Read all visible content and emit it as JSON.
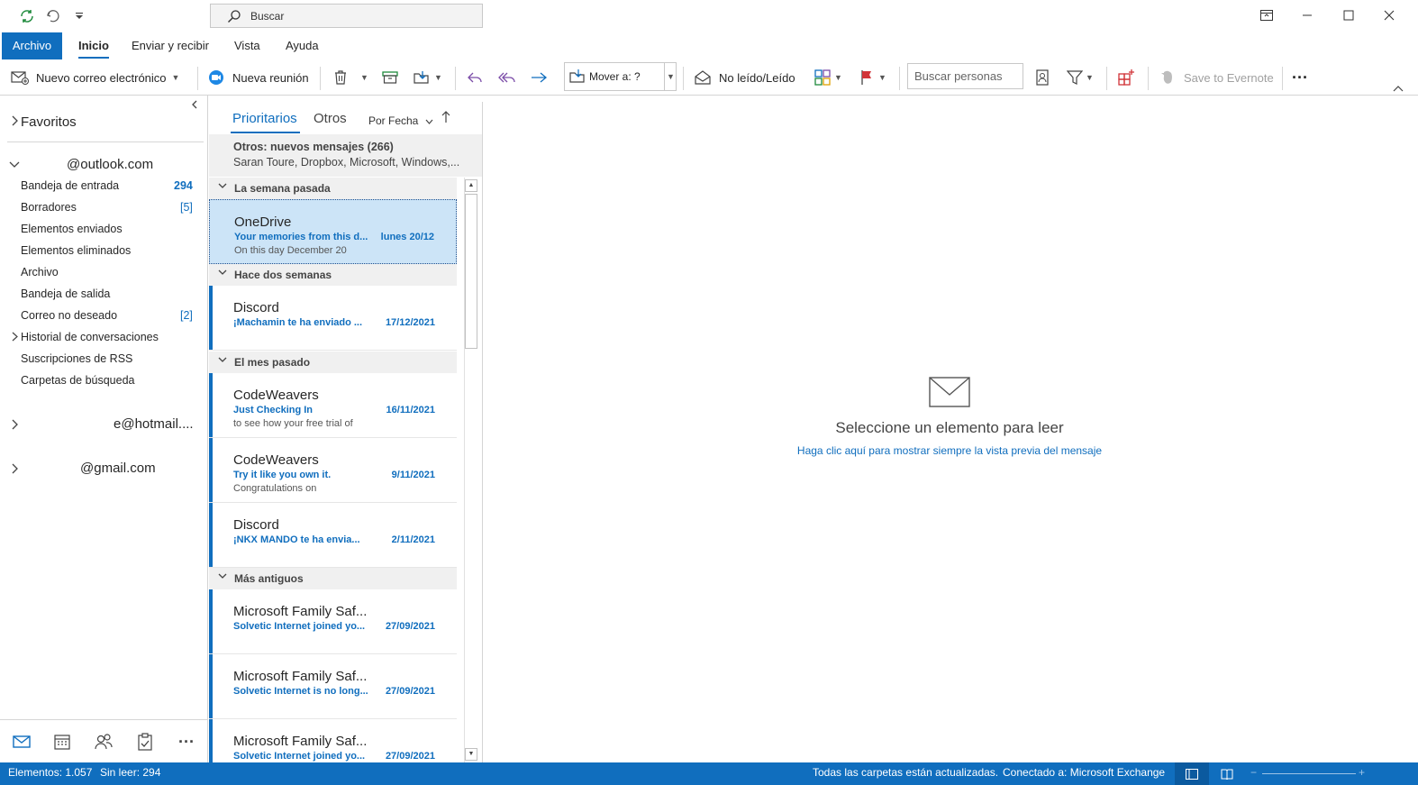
{
  "titlebar": {
    "search_label": "Buscar"
  },
  "menu": {
    "file": "Archivo",
    "home": "Inicio",
    "send_receive": "Enviar y recibir",
    "view": "Vista",
    "help": "Ayuda"
  },
  "ribbon": {
    "new_email": "Nuevo correo electrónico",
    "new_meeting": "Nueva reunión",
    "move_to": "Mover a: ?",
    "unread_read": "No leído/Leído",
    "search_people": "Buscar personas",
    "evernote": "Save to Evernote"
  },
  "folders": {
    "favorites": "Favoritos",
    "account1": "@outlook.com",
    "items": [
      {
        "label": "Bandeja de entrada",
        "count": "294"
      },
      {
        "label": "Borradores",
        "count": "[5]"
      },
      {
        "label": "Elementos enviados",
        "count": ""
      },
      {
        "label": "Elementos eliminados",
        "count": ""
      },
      {
        "label": "Archivo",
        "count": ""
      },
      {
        "label": "Bandeja de salida",
        "count": ""
      },
      {
        "label": "Correo no deseado",
        "count": "[2]"
      },
      {
        "label": "Historial de conversaciones",
        "count": ""
      },
      {
        "label": "Suscripciones de RSS",
        "count": ""
      },
      {
        "label": "Carpetas de búsqueda",
        "count": ""
      }
    ],
    "account2": "e@hotmail....",
    "account3": "@gmail.com"
  },
  "list": {
    "tab_focused": "Prioritarios",
    "tab_other": "Otros",
    "sort_by": "Por Fecha",
    "other_banner_title": "Otros: nuevos mensajes (266)",
    "other_banner_senders": "Saran Toure, Dropbox, Microsoft, Windows,...",
    "groups": [
      "La semana pasada",
      "Hace dos semanas",
      "El mes pasado",
      "Más antiguos"
    ],
    "messages": [
      {
        "sender": "OneDrive",
        "subject": "Your memories from this d...",
        "date": "lunes 20/12",
        "preview": "On this day  December 20"
      },
      {
        "sender": "Discord",
        "subject": "¡Machamin te ha enviado ...",
        "date": "17/12/2021",
        "preview": ""
      },
      {
        "sender": "CodeWeavers",
        "subject": "Just Checking In",
        "date": "16/11/2021",
        "preview": "to see how your free trial of"
      },
      {
        "sender": "CodeWeavers",
        "subject": "Try it like you own it.",
        "date": "9/11/2021",
        "preview": "Congratulations on"
      },
      {
        "sender": "Discord",
        "subject": "¡NKX MANDO te ha envia...",
        "date": "2/11/2021",
        "preview": ""
      },
      {
        "sender": "Microsoft Family Saf...",
        "subject": "Solvetic Internet joined yo...",
        "date": "27/09/2021",
        "preview": ""
      },
      {
        "sender": "Microsoft Family Saf...",
        "subject": "Solvetic Internet is no long...",
        "date": "27/09/2021",
        "preview": ""
      },
      {
        "sender": "Microsoft Family Saf...",
        "subject": "Solvetic Internet joined yo...",
        "date": "27/09/2021",
        "preview": ""
      }
    ]
  },
  "reading": {
    "title": "Seleccione un elemento para leer",
    "link": "Haga clic aquí para mostrar siempre la vista previa del mensaje"
  },
  "status": {
    "items": "Elementos: 1.057",
    "unread": "Sin leer: 294",
    "folders_updated": "Todas las carpetas están actualizadas.",
    "connected": "Conectado a: Microsoft Exchange"
  },
  "colors": {
    "accent": "#106ebe",
    "selected_bg": "#cce4f7"
  }
}
